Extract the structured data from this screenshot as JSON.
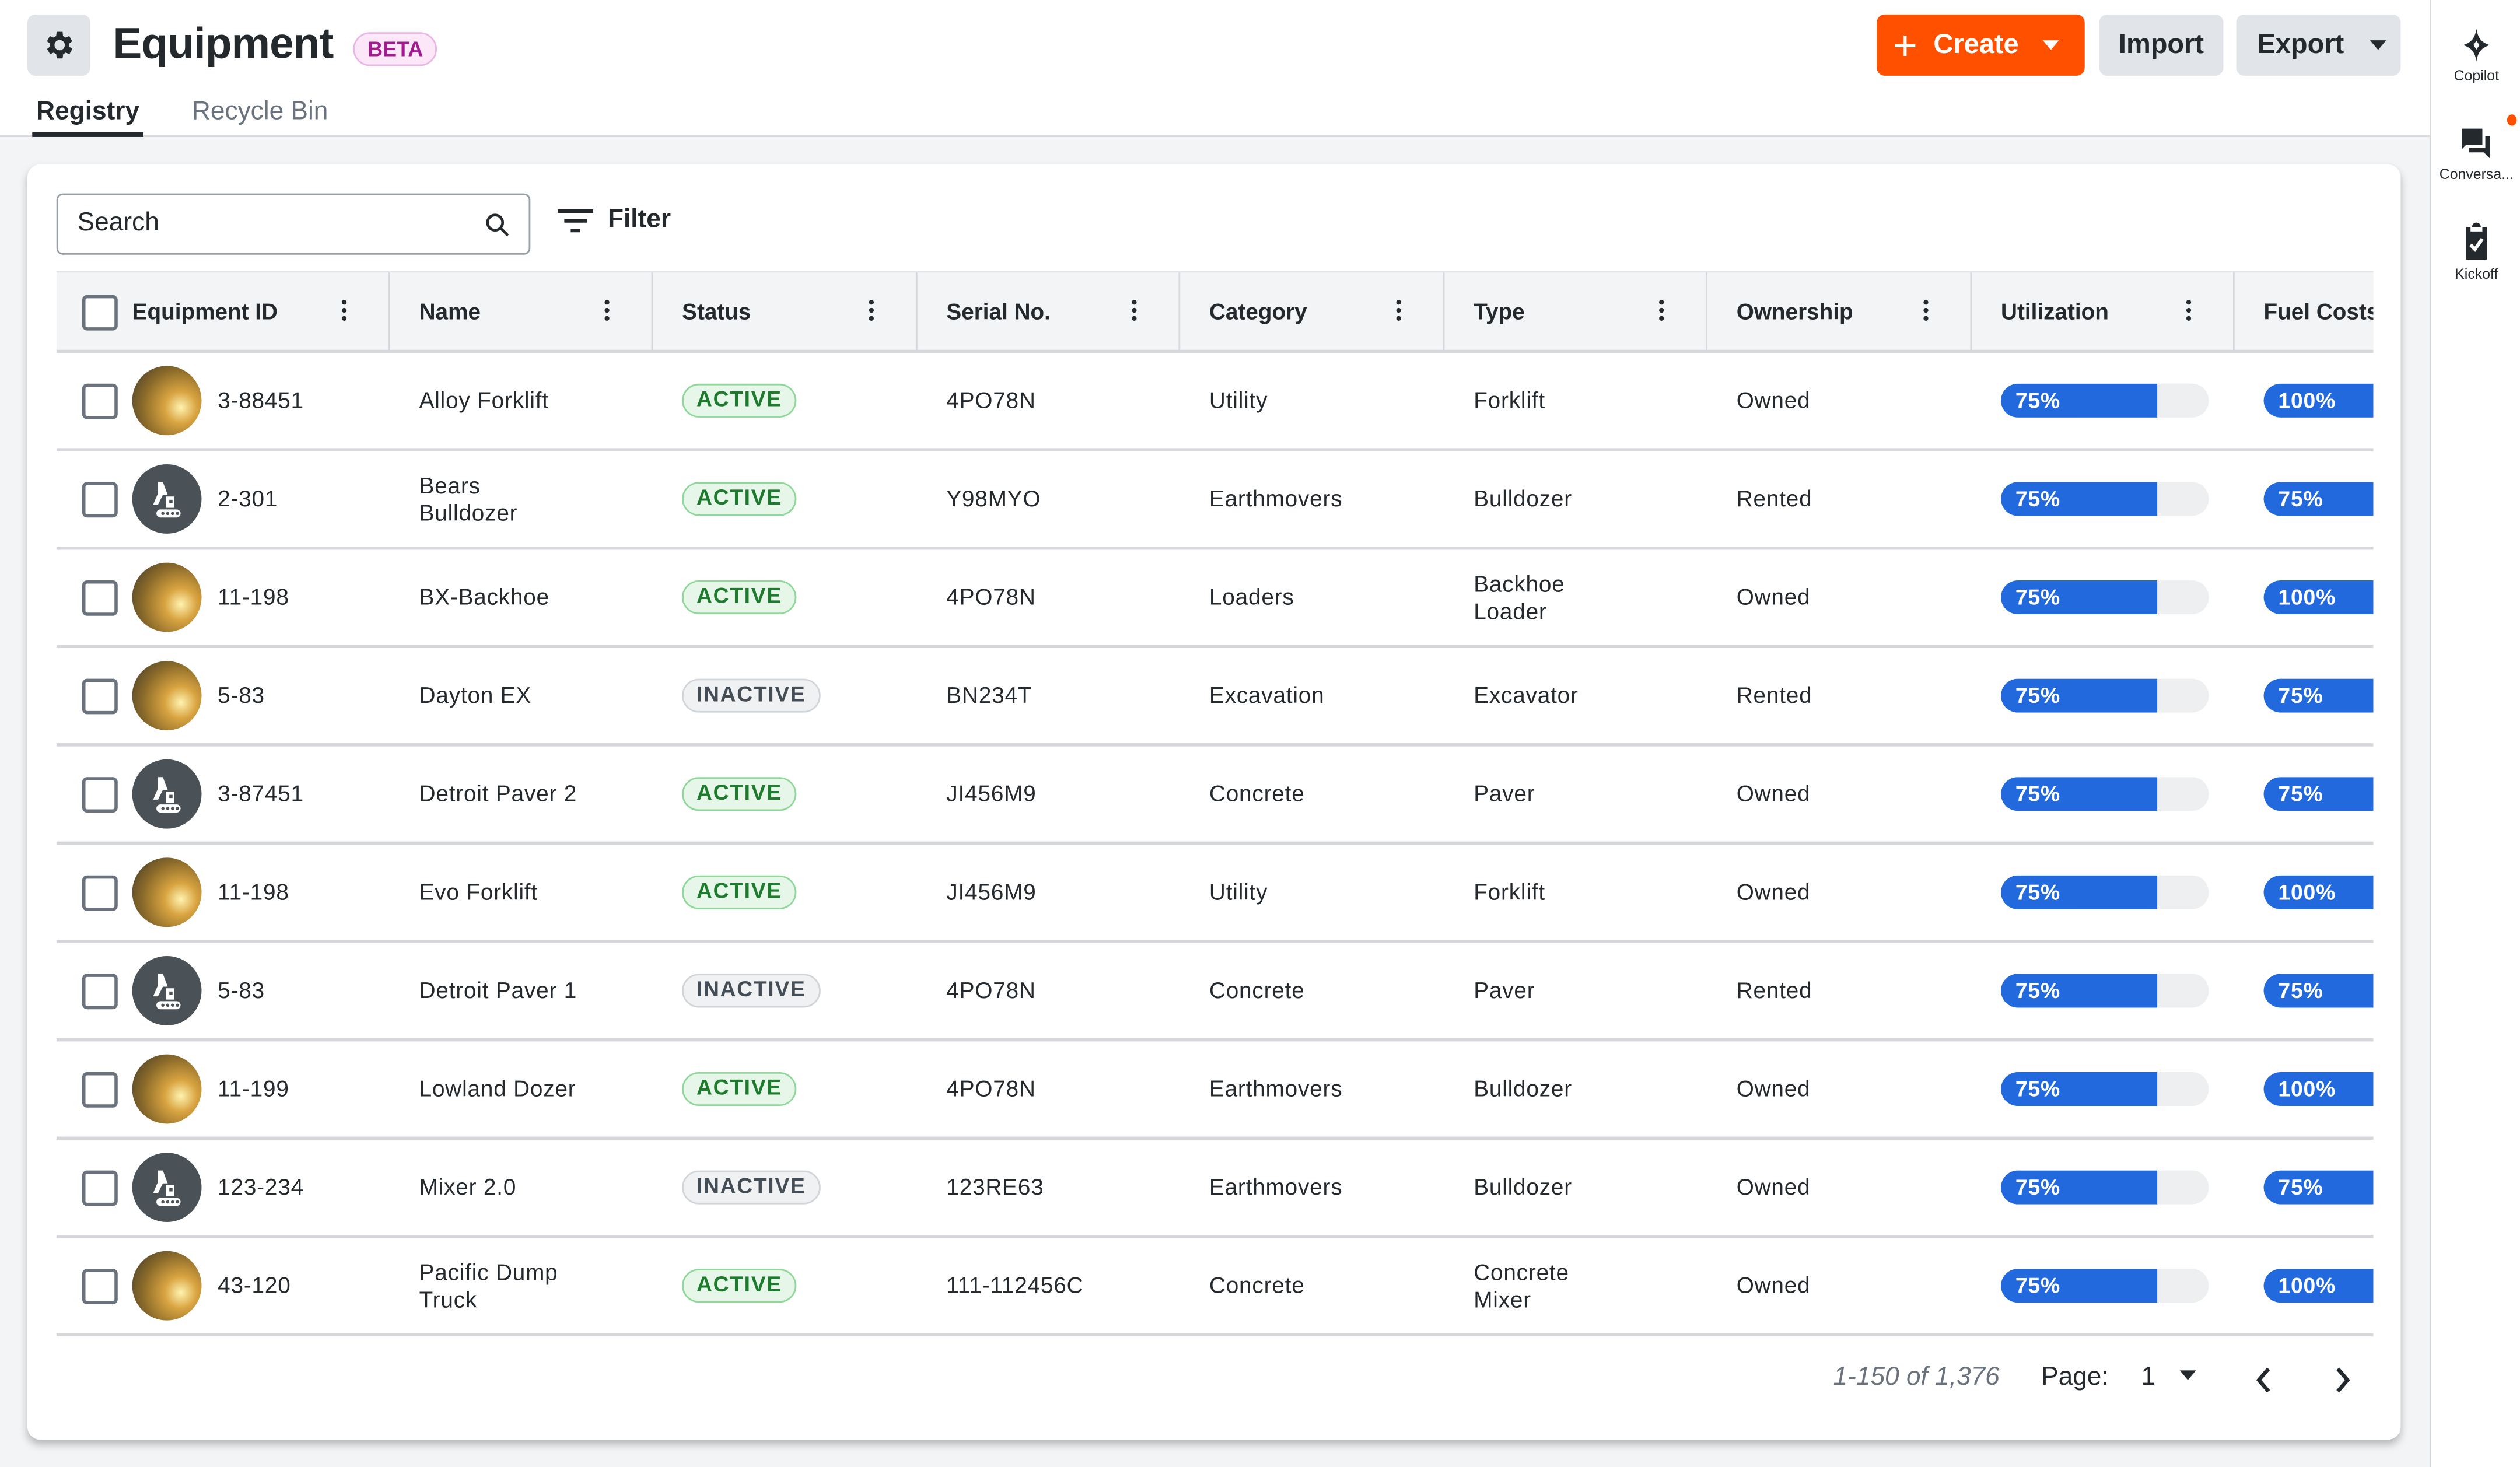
{
  "header": {
    "title": "Equipment",
    "badge": "BETA",
    "create_label": "Create",
    "import_label": "Import",
    "export_label": "Export"
  },
  "tabs": [
    {
      "label": "Registry",
      "active": true
    },
    {
      "label": "Recycle Bin",
      "active": false
    }
  ],
  "sidebar": {
    "items": [
      {
        "label": "Copilot",
        "icon": "sparkle-icon"
      },
      {
        "label": "Conversa...",
        "icon": "chat-icon",
        "notification": true
      },
      {
        "label": "Kickoff",
        "icon": "clipboard-check-icon"
      }
    ]
  },
  "toolbar": {
    "search_placeholder": "Search",
    "filter_label": "Filter"
  },
  "colors": {
    "accent": "#ff5000",
    "progress": "#2269de",
    "active": "#1e7b2e",
    "beta": "#a21c8f"
  },
  "table": {
    "columns": [
      "Equipment ID",
      "Name",
      "Status",
      "Serial No.",
      "Category",
      "Type",
      "Ownership",
      "Utilization",
      "Fuel Costs"
    ],
    "rows": [
      {
        "avatar": "photo",
        "id": "3-88451",
        "name": "Alloy Forklift",
        "status": "ACTIVE",
        "serial": "4PO78N",
        "category": "Utility",
        "type": "Forklift",
        "ownership": "Owned",
        "utilization": 75,
        "fuel": 100
      },
      {
        "avatar": "icon",
        "id": "2-301",
        "name": "Bears Bulldozer",
        "status": "ACTIVE",
        "serial": "Y98MYO",
        "category": "Earthmovers",
        "type": "Bulldozer",
        "ownership": "Rented",
        "utilization": 75,
        "fuel": 75
      },
      {
        "avatar": "photo",
        "id": "11-198",
        "name": "BX-Backhoe",
        "status": "ACTIVE",
        "serial": "4PO78N",
        "category": "Loaders",
        "type": "Backhoe Loader",
        "ownership": "Owned",
        "utilization": 75,
        "fuel": 100
      },
      {
        "avatar": "photo",
        "id": "5-83",
        "name": "Dayton EX",
        "status": "INACTIVE",
        "serial": "BN234T",
        "category": "Excavation",
        "type": "Excavator",
        "ownership": "Rented",
        "utilization": 75,
        "fuel": 75
      },
      {
        "avatar": "icon",
        "id": "3-87451",
        "name": "Detroit Paver 2",
        "status": "ACTIVE",
        "serial": "JI456M9",
        "category": "Concrete",
        "type": "Paver",
        "ownership": "Owned",
        "utilization": 75,
        "fuel": 75
      },
      {
        "avatar": "photo",
        "id": "11-198",
        "name": "Evo Forklift",
        "status": "ACTIVE",
        "serial": "JI456M9",
        "category": "Utility",
        "type": "Forklift",
        "ownership": "Owned",
        "utilization": 75,
        "fuel": 100
      },
      {
        "avatar": "icon",
        "id": "5-83",
        "name": "Detroit Paver 1",
        "status": "INACTIVE",
        "serial": "4PO78N",
        "category": "Concrete",
        "type": "Paver",
        "ownership": "Rented",
        "utilization": 75,
        "fuel": 75
      },
      {
        "avatar": "photo",
        "id": "11-199",
        "name": "Lowland Dozer",
        "status": "ACTIVE",
        "serial": "4PO78N",
        "category": "Earthmovers",
        "type": "Bulldozer",
        "ownership": "Owned",
        "utilization": 75,
        "fuel": 100
      },
      {
        "avatar": "icon",
        "id": "123-234",
        "name": "Mixer 2.0",
        "status": "INACTIVE",
        "serial": "123RE63",
        "category": "Earthmovers",
        "type": "Bulldozer",
        "ownership": "Owned",
        "utilization": 75,
        "fuel": 75
      },
      {
        "avatar": "photo",
        "id": "43-120",
        "name": "Pacific Dump Truck",
        "status": "ACTIVE",
        "serial": "111-112456C",
        "category": "Concrete",
        "type": "Concrete Mixer",
        "ownership": "Owned",
        "utilization": 75,
        "fuel": 100
      }
    ]
  },
  "pagination": {
    "range": "1-150 of 1,376",
    "page_label": "Page:",
    "page": "1"
  }
}
